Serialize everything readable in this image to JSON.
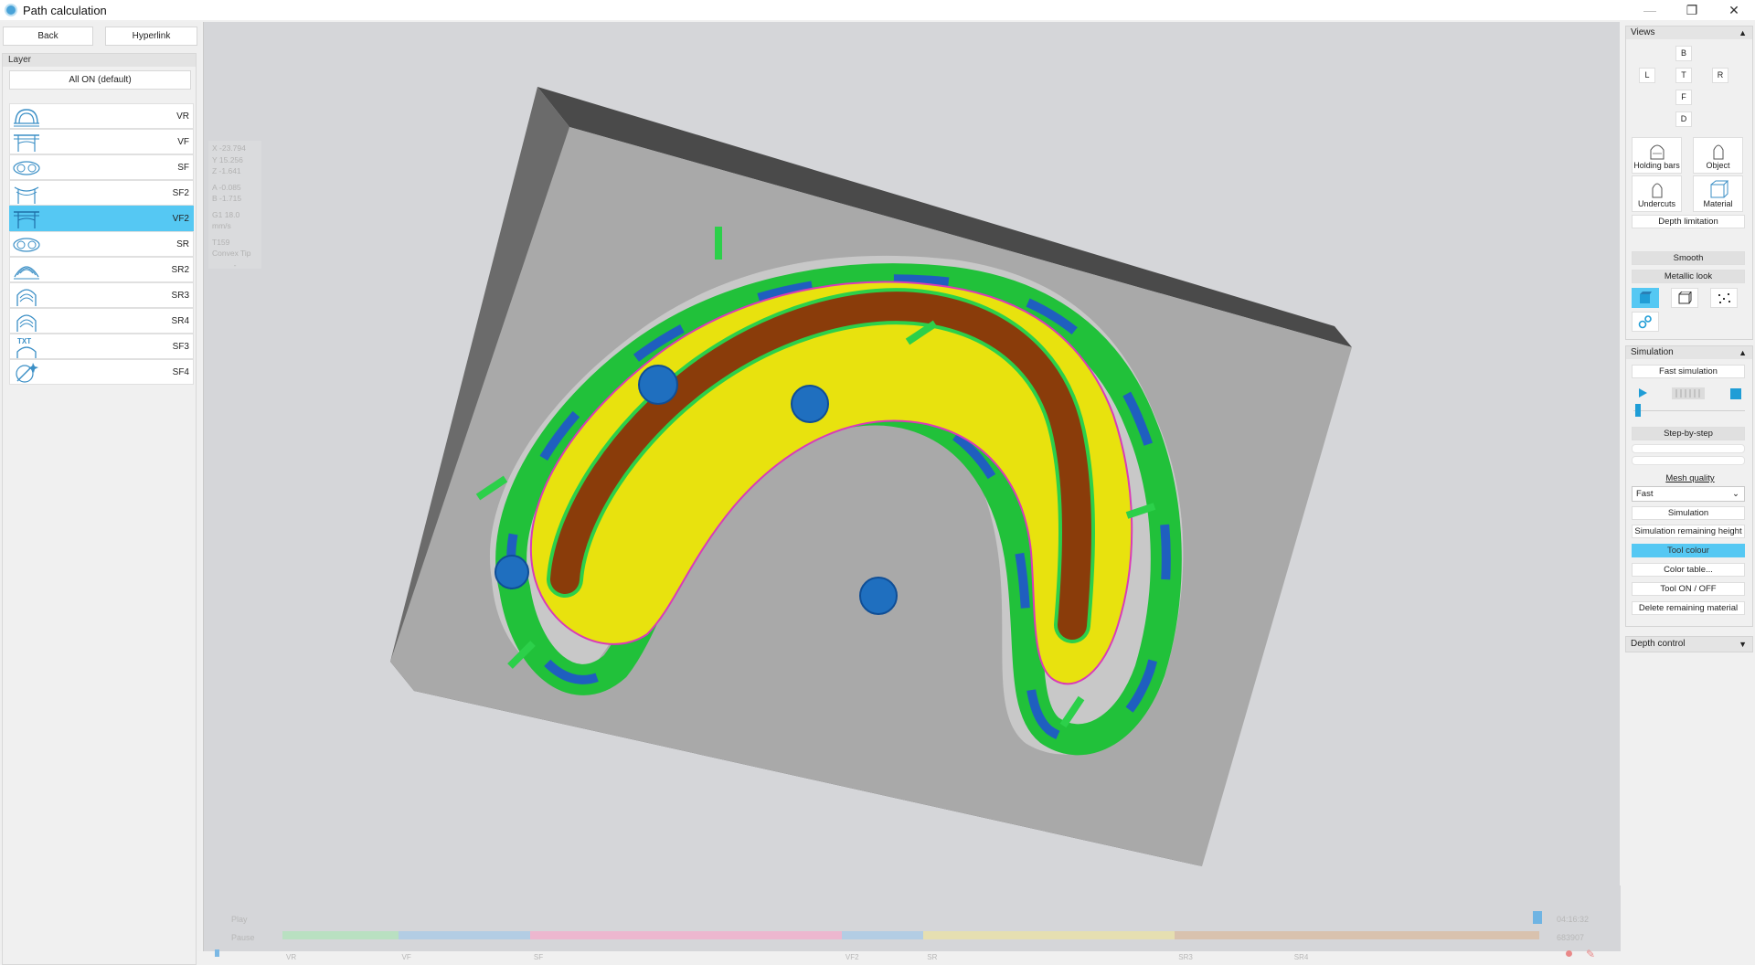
{
  "window": {
    "title": "Path calculation",
    "min": "—",
    "restore": "❐",
    "close": "✕"
  },
  "toolbar": {
    "back": "Back",
    "hyperlink": "Hyperlink"
  },
  "layer": {
    "header": "Layer",
    "all_on": "All ON (default)",
    "items": [
      {
        "label": "VR",
        "icon": "vr-strategy-icon"
      },
      {
        "label": "VF",
        "icon": "vf-strategy-icon"
      },
      {
        "label": "SF",
        "icon": "sf-strategy-icon"
      },
      {
        "label": "SF2",
        "icon": "sf2-strategy-icon"
      },
      {
        "label": "VF2",
        "icon": "vf2-strategy-icon",
        "active": true
      },
      {
        "label": "SR",
        "icon": "sr-strategy-icon"
      },
      {
        "label": "SR2",
        "icon": "sr2-strategy-icon"
      },
      {
        "label": "SR3",
        "icon": "sr3-strategy-icon"
      },
      {
        "label": "SR4",
        "icon": "sr4-strategy-icon"
      },
      {
        "label": "SF3",
        "icon": "text-strategy-icon"
      },
      {
        "label": "SF4",
        "icon": "tool-strategy-icon"
      }
    ],
    "icon_text": "TXT"
  },
  "coords": {
    "x": "X  -23.794",
    "y": "Y  15.256",
    "z": "Z  -1.641",
    "a": "A  -0.085",
    "b": "B  -1.715",
    "feed": "G1   18.0 mm/s",
    "tool": "T159 Convex Tip",
    "dash": "-"
  },
  "timeline": {
    "play": "Play",
    "pause": "Pause",
    "time": "04:16:32",
    "count": "683907",
    "segments": [
      {
        "label": "VR",
        "color": "#b9e0c1",
        "start": 0.0,
        "end": 0.092
      },
      {
        "label": "VF",
        "color": "#b3cde4",
        "start": 0.092,
        "end": 0.197
      },
      {
        "label": "SF",
        "color": "#edb7cf",
        "start": 0.197,
        "end": 0.445
      },
      {
        "label": "VF2",
        "color": "#b3cde4",
        "start": 0.445,
        "end": 0.51
      },
      {
        "label": "SR",
        "color": "#e6dfb1",
        "start": 0.51,
        "end": 0.71
      },
      {
        "label": "SR3",
        "color": "#d9c2ae",
        "start": 0.71,
        "end": 0.802
      },
      {
        "label": "SR4",
        "color": "#d9c2ae",
        "start": 0.802,
        "end": 1.0
      }
    ]
  },
  "views": {
    "header": "Views",
    "b": "B",
    "l": "L",
    "t": "T",
    "r": "R",
    "f": "F",
    "d": "D",
    "holding_bars": "Holding bars",
    "object": "Object",
    "undercuts": "Undercuts",
    "material": "Material",
    "depth_limitation": "Depth limitation",
    "smooth": "Smooth",
    "metallic": "Metallic look"
  },
  "simulation": {
    "header": "Simulation",
    "fast": "Fast simulation",
    "step": "Step-by-step",
    "progress": 0.02,
    "mesh_quality": "Mesh quality",
    "mesh_value": "Fast",
    "simulation": "Simulation",
    "remaining_height": "Simulation remaining height",
    "tool_colour": "Tool colour",
    "color_table": "Color table...",
    "tool_onoff": "Tool ON / OFF",
    "delete_remaining": "Delete remaining material"
  },
  "depth_control": {
    "header": "Depth control"
  }
}
